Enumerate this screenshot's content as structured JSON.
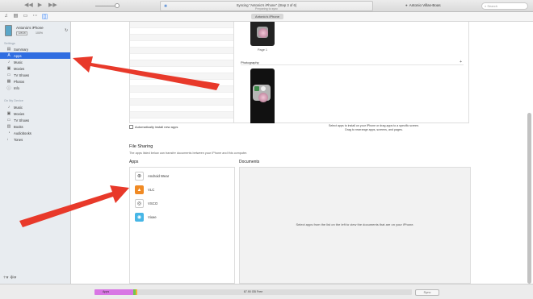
{
  "window": {
    "lcd_title": "Syncing \"Antonio's iPhone\" (Step 3 of 6)",
    "lcd_subtitle": "Preparing to sync",
    "user_name": "Antonio Villas-Boas",
    "search_placeholder": "Search"
  },
  "toolbar": {
    "device_tab": "Antonio's iPhone"
  },
  "device": {
    "name": "Antonio's iPhone",
    "capacity": "128GB",
    "battery": "100%"
  },
  "sidebar": {
    "settings_header": "Settings",
    "settings_items": [
      {
        "label": "Summary",
        "icon": "summary-icon"
      },
      {
        "label": "Apps",
        "icon": "apps-icon"
      },
      {
        "label": "Music",
        "icon": "music-icon"
      },
      {
        "label": "Movies",
        "icon": "movies-icon"
      },
      {
        "label": "TV Shows",
        "icon": "tv-icon"
      },
      {
        "label": "Photos",
        "icon": "photos-icon"
      },
      {
        "label": "Info",
        "icon": "info-icon"
      }
    ],
    "ondevice_header": "On My Device",
    "ondevice_items": [
      {
        "label": "Music",
        "icon": "music-icon"
      },
      {
        "label": "Movies",
        "icon": "movies-icon"
      },
      {
        "label": "TV Shows",
        "icon": "tv-icon"
      },
      {
        "label": "Books",
        "icon": "books-icon"
      },
      {
        "label": "Audiobooks",
        "icon": "audiobooks-icon"
      },
      {
        "label": "Tones",
        "icon": "tones-icon"
      }
    ],
    "selected": "Apps"
  },
  "home_screens": {
    "page_label": "Page 1",
    "category": "Photography"
  },
  "apps_panel": {
    "auto_install_label": "Automatically install new apps",
    "hint_line1": "Select apps to install on your iPhone or drag apps to a specific screen.",
    "hint_line2": "Drag to rearrange apps, screens, and pages."
  },
  "file_sharing": {
    "title": "File Sharing",
    "description": "The apps listed below can transfer documents between your iPhone and this computer.",
    "apps_label": "Apps",
    "documents_label": "Documents",
    "apps": [
      {
        "name": "Android Wear",
        "color": "#ffffff"
      },
      {
        "name": "VLC",
        "color": "#f08a24"
      },
      {
        "name": "VSCO",
        "color": "#ffffff"
      },
      {
        "name": "Vixee",
        "color": "#47b6e6"
      }
    ],
    "documents_message": "Select apps from the list on the left to view the documents that are on your iPhone."
  },
  "capacity_bar": {
    "apps_label": "Apps",
    "free_label": "67.90 GB Free",
    "sync_button": "Sync"
  },
  "colors": {
    "selection": "#2f6de1",
    "arrow": "#e8392a",
    "apps_segment": "#d876e4"
  }
}
